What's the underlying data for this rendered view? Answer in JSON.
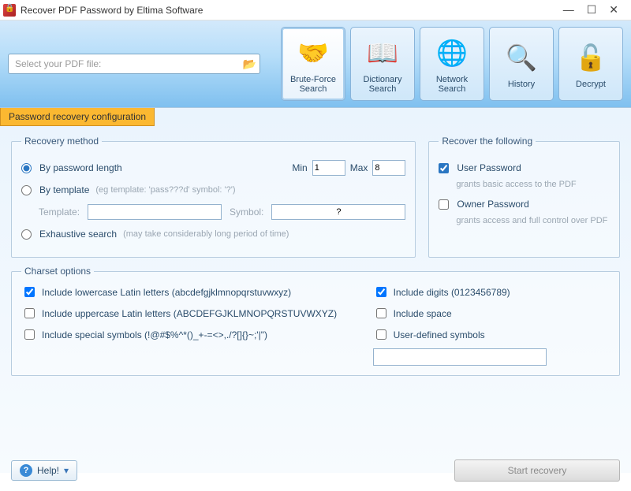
{
  "window": {
    "title": "Recover PDF Password by Eltima Software"
  },
  "toolbar": {
    "file_placeholder": "Select your PDF file:",
    "buttons": {
      "brute": "Brute-Force Search",
      "dict": "Dictionary Search",
      "net": "Network Search",
      "history": "History",
      "decrypt": "Decrypt"
    }
  },
  "tab": {
    "label": "Password recovery configuration"
  },
  "recovery_method": {
    "legend": "Recovery method",
    "by_length": "By password length",
    "min_label": "Min",
    "min_value": "1",
    "max_label": "Max",
    "max_value": "8",
    "by_template": "By template",
    "template_hint": "(eg template: 'pass???d' symbol: '?')",
    "template_label": "Template:",
    "template_value": "",
    "symbol_label": "Symbol:",
    "symbol_value": "?",
    "exhaustive": "Exhaustive search",
    "exhaustive_hint": "(may take considerably long period of time)"
  },
  "recover_following": {
    "legend": "Recover the following",
    "user_pw": "User Password",
    "user_pw_hint": "grants basic access to the PDF",
    "owner_pw": "Owner Password",
    "owner_pw_hint": "grants access and full control over PDF"
  },
  "charset": {
    "legend": "Charset options",
    "lowercase": "Include lowercase Latin letters (abcdefgjklmnopqrstuvwxyz)",
    "uppercase": "Include uppercase Latin letters (ABCDEFGJKLMNOPQRSTUVWXYZ)",
    "special": "Include special symbols (!@#$%^*()_+-=<>,./?[]{}~;'|\")",
    "digits": "Include digits (0123456789)",
    "space": "Include space",
    "user_defined": "User-defined symbols"
  },
  "footer": {
    "help": "Help!",
    "start": "Start recovery"
  }
}
